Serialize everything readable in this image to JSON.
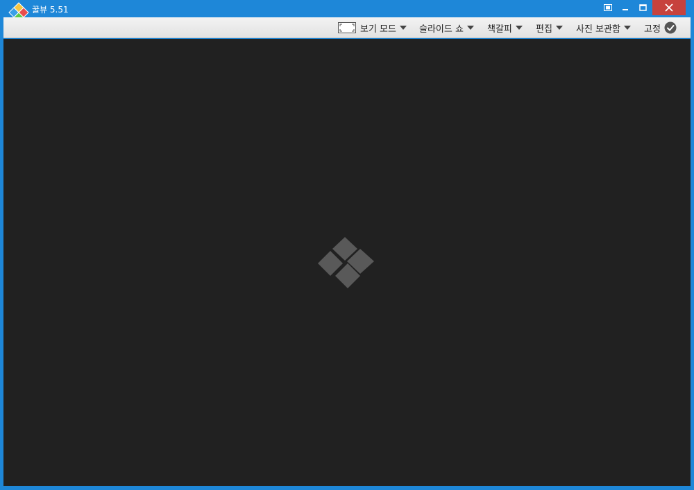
{
  "window": {
    "title": "꿀뷰 5.51",
    "colors": {
      "frame": "#1e87d8",
      "close": "#c7423d",
      "viewer_bg": "#212121"
    }
  },
  "toolbar": {
    "view_mode_label": "보기 모드",
    "slideshow_label": "슬라이드 쇼",
    "bookmark_label": "책갈피",
    "edit_label": "편집",
    "album_label": "사진 보관함",
    "pin_label": "고정"
  },
  "icons": {
    "app_logo": "diamond-logo-icon",
    "fullscreen": "fullscreen-icon",
    "minimize": "minimize-icon",
    "maximize": "maximize-icon",
    "close": "close-icon",
    "view_mode": "view-mode-frame-icon",
    "pin_check": "check-circle-icon",
    "viewer_placeholder": "diamond-logo-icon"
  }
}
